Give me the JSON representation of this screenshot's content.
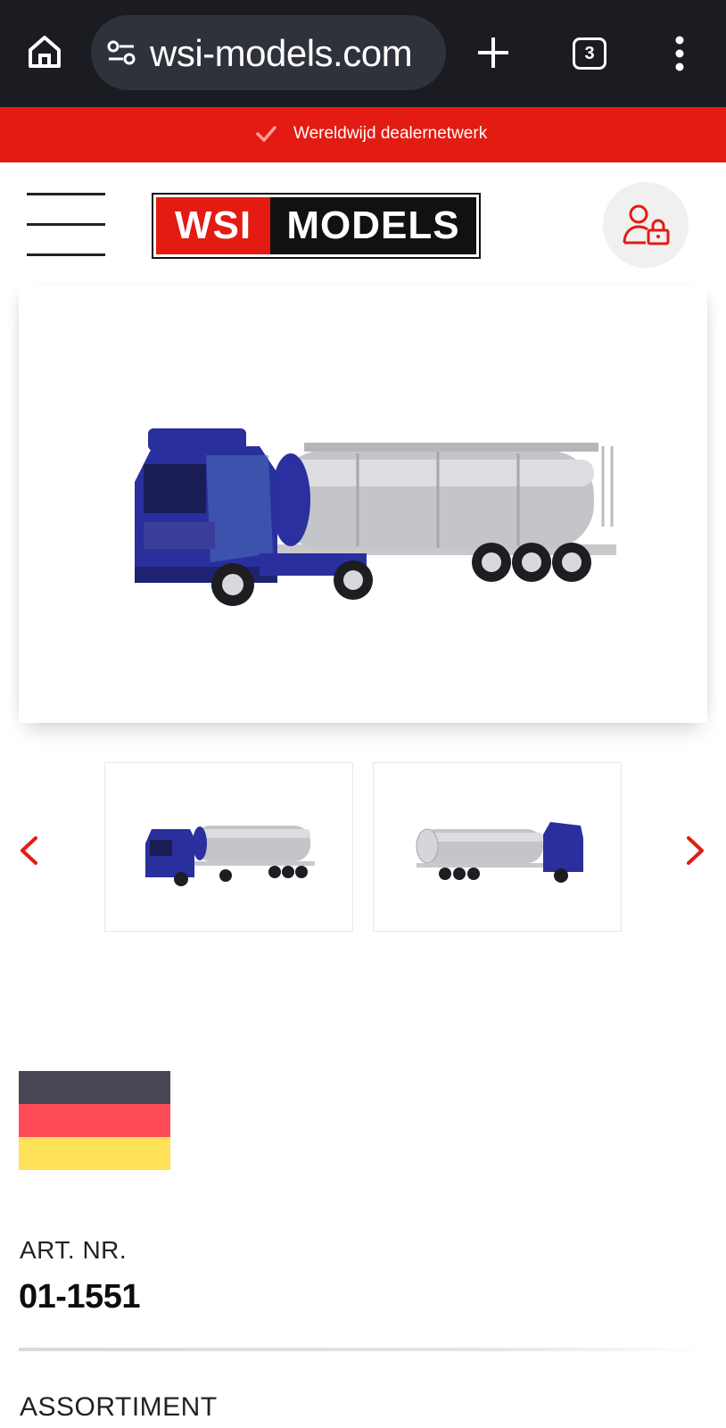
{
  "browser": {
    "url": "wsi-models.com",
    "tab_count": "3"
  },
  "promo": {
    "text": "Wereldwijd dealernetwerk"
  },
  "header": {
    "logo_left": "WSI",
    "logo_right": "MODELS"
  },
  "gallery": {
    "main_image_icon": "truck-tanker-image",
    "thumbnails": [
      "truck-front-view",
      "truck-rear-view"
    ]
  },
  "product": {
    "flag_colors": [
      "#484755",
      "#ff4a57",
      "#ffe15a"
    ],
    "art_label": "ART. NR.",
    "art_number": "01-1551",
    "assortment_label": "ASSORTIMENT"
  },
  "colors": {
    "brand_red": "#e31b12",
    "browser_bg": "#1b1c21"
  }
}
